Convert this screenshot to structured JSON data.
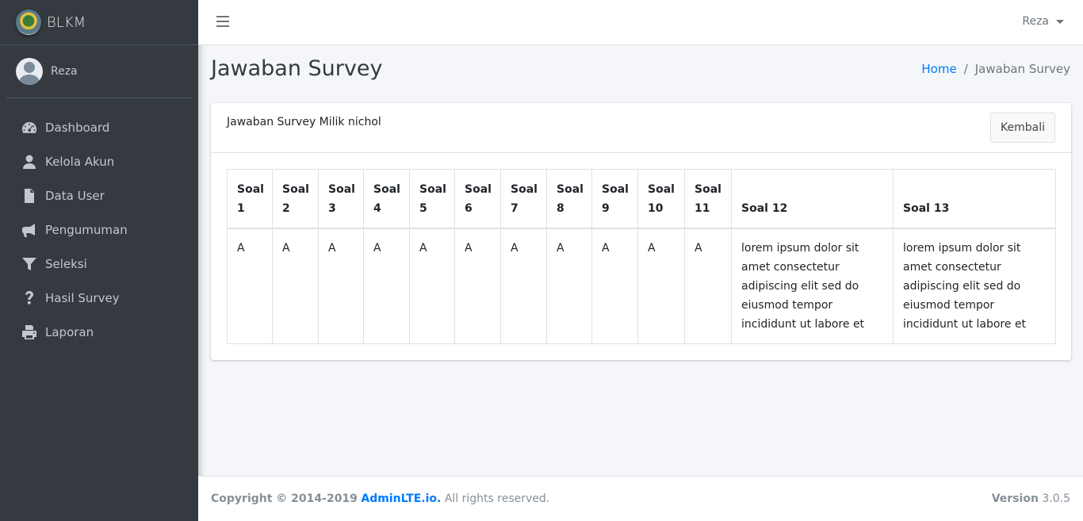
{
  "brand": {
    "name": "BLKM"
  },
  "user": {
    "name": "Reza"
  },
  "sidebar": {
    "items": [
      {
        "label": "Dashboard",
        "icon": "tachometer-icon"
      },
      {
        "label": "Kelola Akun",
        "icon": "user-icon"
      },
      {
        "label": "Data User",
        "icon": "file-icon"
      },
      {
        "label": "Pengumuman",
        "icon": "bullhorn-icon"
      },
      {
        "label": "Seleksi",
        "icon": "filter-icon"
      },
      {
        "label": "Hasil Survey",
        "icon": "question-icon"
      },
      {
        "label": "Laporan",
        "icon": "print-icon"
      }
    ]
  },
  "navbar": {
    "user_name": "Reza"
  },
  "header": {
    "title": "Jawaban Survey"
  },
  "breadcrumb": {
    "home": "Home",
    "separator": "/",
    "current": "Jawaban Survey"
  },
  "card": {
    "title": "Jawaban Survey Milik nichol",
    "back_label": "Kembali"
  },
  "table": {
    "headers": [
      "Soal 1",
      "Soal 2",
      "Soal 3",
      "Soal 4",
      "Soal 5",
      "Soal 6",
      "Soal 7",
      "Soal 8",
      "Soal 9",
      "Soal 10",
      "Soal 11",
      "Soal 12",
      "Soal 13"
    ],
    "row": [
      "A",
      "A",
      "A",
      "A",
      "A",
      "A",
      "A",
      "A",
      "A",
      "A",
      "A",
      "lorem ipsum dolor sit amet consectetur adipiscing elit sed do eiusmod tempor incididunt ut labore et",
      "lorem ipsum dolor sit amet consectetur adipiscing elit sed do eiusmod tempor incididunt ut labore et"
    ]
  },
  "footer": {
    "copyright_prefix": "Copyright © 2014-2019",
    "link": "AdminLTE.io.",
    "suffix": "All rights reserved.",
    "version_label": "Version",
    "version": "3.0.5"
  }
}
